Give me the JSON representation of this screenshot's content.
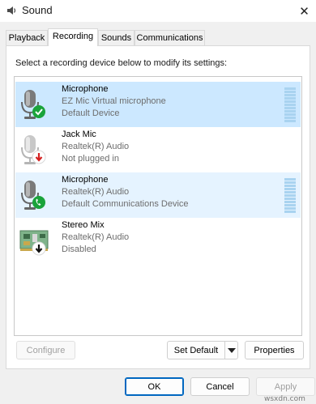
{
  "window": {
    "title": "Sound",
    "close_glyph": "✕",
    "icon": "speaker-icon"
  },
  "tabs": [
    {
      "label": "Playback",
      "active": false
    },
    {
      "label": "Recording",
      "active": true
    },
    {
      "label": "Sounds",
      "active": false
    },
    {
      "label": "Communications",
      "active": false
    }
  ],
  "panel": {
    "instruction": "Select a recording device below to modify its settings:"
  },
  "devices": [
    {
      "name": "Microphone",
      "description": "EZ Mic Virtual microphone",
      "status": "Default Device",
      "icon": "microphone-icon",
      "badge": "green-check-badge-icon",
      "selected": true,
      "has_meter": true
    },
    {
      "name": "Jack Mic",
      "description": "Realtek(R) Audio",
      "status": "Not plugged in",
      "icon": "microphone-icon",
      "badge": "red-down-arrow-badge-icon",
      "selected": false,
      "has_meter": false
    },
    {
      "name": "Microphone",
      "description": "Realtek(R) Audio",
      "status": "Default Communications Device",
      "icon": "microphone-icon",
      "badge": "green-phone-badge-icon",
      "selected": false,
      "has_meter": true
    },
    {
      "name": "Stereo Mix",
      "description": "Realtek(R) Audio",
      "status": "Disabled",
      "icon": "circuit-board-icon",
      "badge": "black-down-arrow-badge-icon",
      "selected": false,
      "has_meter": false
    }
  ],
  "buttons": {
    "configure": "Configure",
    "set_default": "Set Default",
    "properties": "Properties",
    "ok": "OK",
    "cancel": "Cancel",
    "apply": "Apply"
  },
  "watermark": "wsxdn.com",
  "colors": {
    "selection": "#cce8ff",
    "hover": "#e5f3ff",
    "meter": "#a9d3f0",
    "check_green": "#1aa33a",
    "accent": "#0067c0"
  }
}
